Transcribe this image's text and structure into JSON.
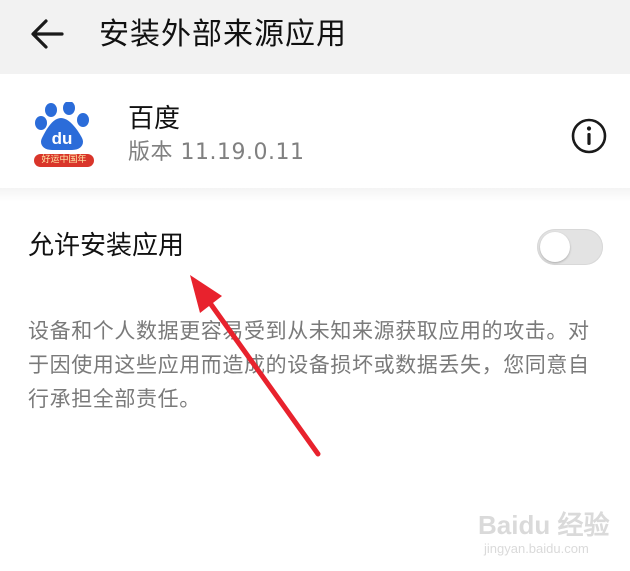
{
  "appbar": {
    "title": "安装外部来源应用",
    "back_icon": "arrow-left-icon"
  },
  "app": {
    "name": "百度",
    "version": "版本 11.19.0.11",
    "icon": "baidu-paw-logo",
    "icon_badge_text": "好运中国年",
    "info_icon": "info-circle-icon"
  },
  "setting": {
    "label": "允许安装应用",
    "toggle_state": "off"
  },
  "warning": {
    "text": "设备和个人数据更容易受到从未知来源获取应用的攻击。对于因使用这些应用而造成的设备损坏或数据丢失，您同意自行承担全部责任。"
  },
  "watermark": {
    "brand": "Baidu 经验",
    "url": "jingyan.baidu.com"
  },
  "colors": {
    "appbar_bg": "#f2f2f2",
    "annotation_arrow": "#e8222d",
    "baidu_blue": "#2b6cd9",
    "badge_red": "#d9352a",
    "secondary_text": "#808080"
  }
}
